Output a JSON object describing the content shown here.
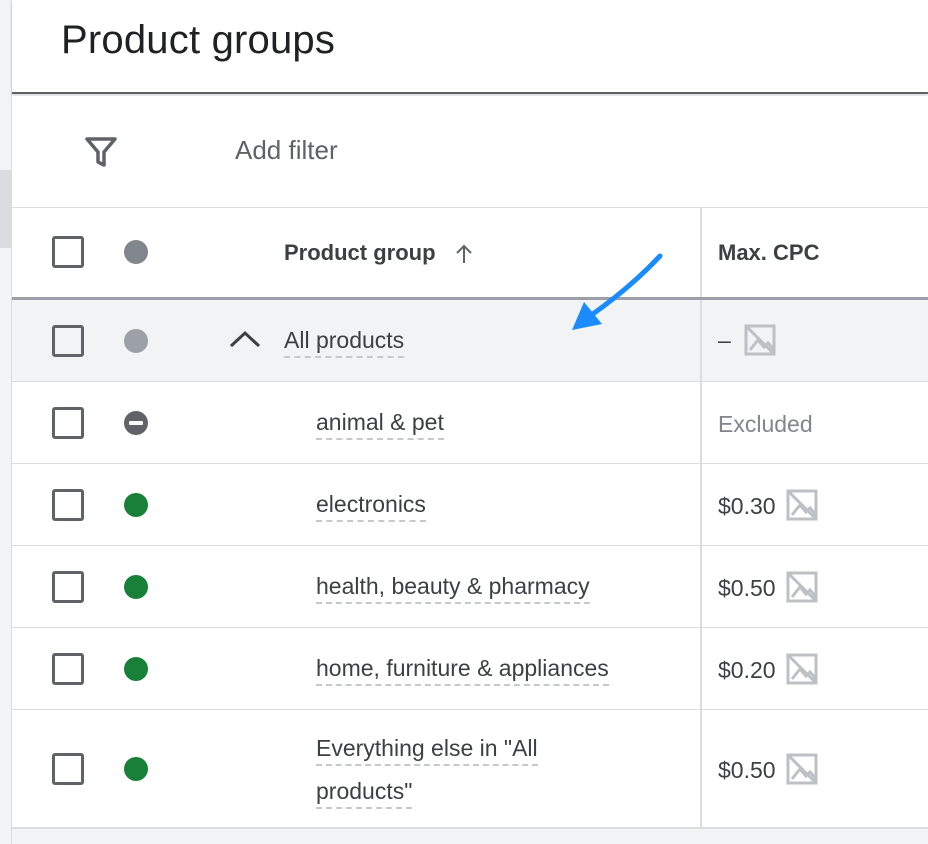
{
  "page": {
    "title": "Product groups"
  },
  "filter": {
    "label": "Add filter",
    "icon": "filter-icon"
  },
  "table": {
    "header": {
      "product_group": "Product group",
      "max_cpc": "Max. CPC",
      "sort_icon": "arrow-up-icon"
    },
    "root": {
      "name": "All products",
      "max_cpc": "–",
      "status": "grey",
      "expanded": true
    },
    "rows": [
      {
        "name": "animal & pet",
        "max_cpc": "Excluded",
        "status": "excluded"
      },
      {
        "name": "electronics",
        "max_cpc": "$0.30",
        "status": "green"
      },
      {
        "name": "health, beauty & pharmacy",
        "max_cpc": "$0.50",
        "status": "green"
      },
      {
        "name": "home, furniture & appliances",
        "max_cpc": "$0.20",
        "status": "green"
      },
      {
        "name_line1": "Everything else in \"All",
        "name_line2": "products\"",
        "max_cpc": "$0.50",
        "status": "green"
      }
    ]
  },
  "colors": {
    "accent_arrow": "#1a8cff",
    "enabled": "#188038",
    "text": "#3c4043"
  }
}
